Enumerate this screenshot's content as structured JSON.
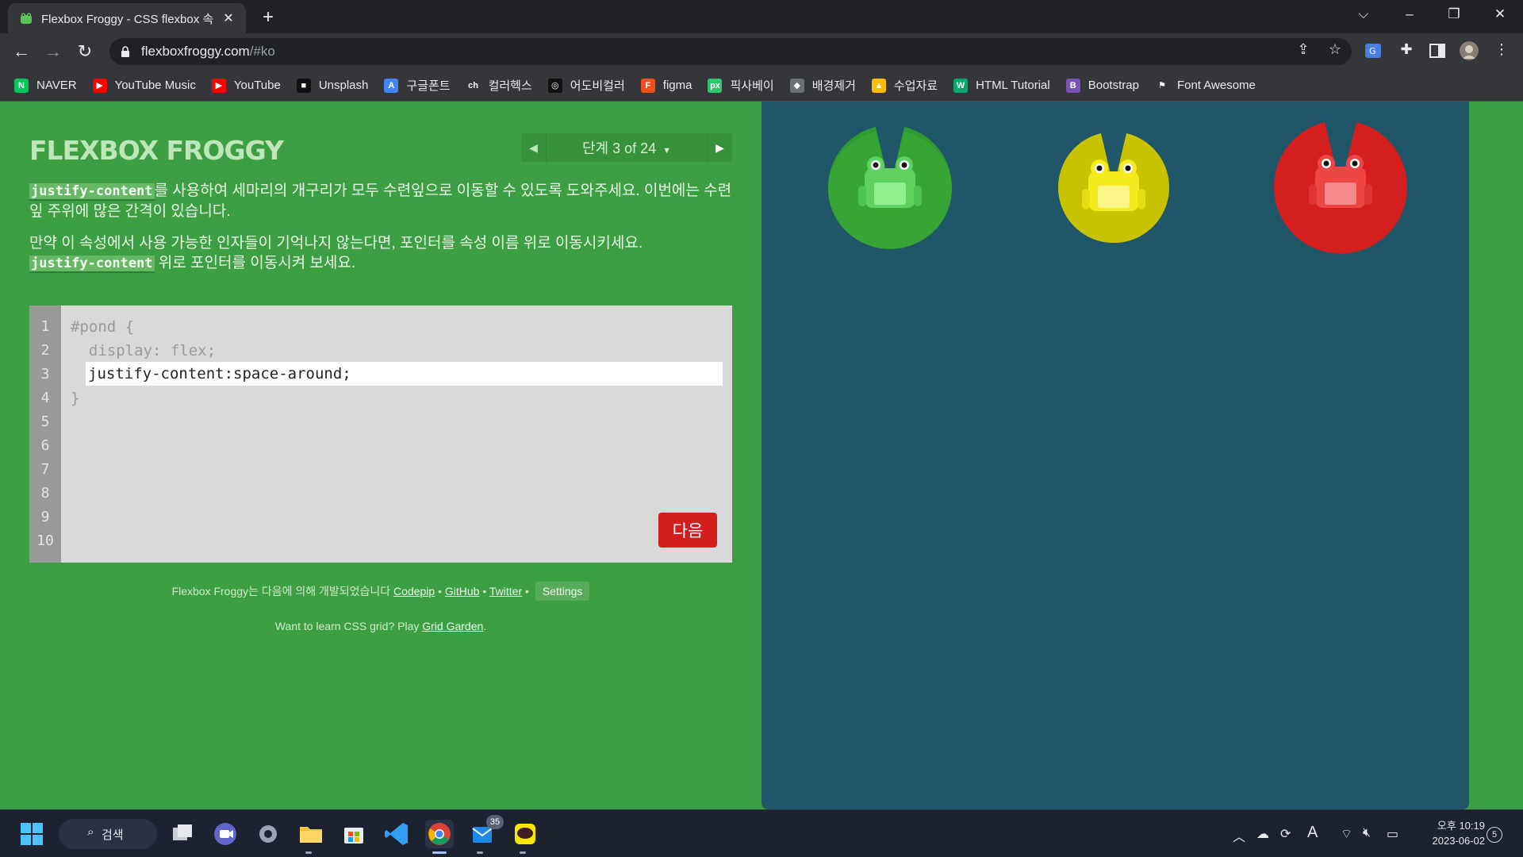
{
  "browser": {
    "tab_title": "Flexbox Froggy - CSS flexbox 속",
    "url_host": "flexboxfroggy.com",
    "url_path": "/#ko"
  },
  "bookmarks": [
    {
      "label": "NAVER",
      "icon": "naver-icon",
      "color": "#03c75a",
      "glyph": "N"
    },
    {
      "label": "YouTube Music",
      "icon": "youtube-music-icon",
      "color": "#ff0000",
      "glyph": "▶"
    },
    {
      "label": "YouTube",
      "icon": "youtube-icon",
      "color": "#ff0000",
      "glyph": "▶"
    },
    {
      "label": "Unsplash",
      "icon": "unsplash-icon",
      "color": "#111111",
      "glyph": "■"
    },
    {
      "label": "구글폰트",
      "icon": "google-fonts-icon",
      "color": "#4285f4",
      "glyph": "A"
    },
    {
      "label": "컬러헥스",
      "icon": "colorhex-icon",
      "color": "#35363a",
      "glyph": "ch"
    },
    {
      "label": "어도비컬러",
      "icon": "adobe-color-icon",
      "color": "#111111",
      "glyph": "◎"
    },
    {
      "label": "figma",
      "icon": "figma-icon",
      "color": "#f24e1e",
      "glyph": "F"
    },
    {
      "label": "픽사베이",
      "icon": "pixabay-icon",
      "color": "#2ec66d",
      "glyph": "px"
    },
    {
      "label": "배경제거",
      "icon": "remove-bg-icon",
      "color": "#6b6f76",
      "glyph": "◆"
    },
    {
      "label": "수업자료",
      "icon": "google-drive-icon",
      "color": "#fbbc04",
      "glyph": "▲"
    },
    {
      "label": "HTML Tutorial",
      "icon": "w3schools-icon",
      "color": "#04aa6d",
      "glyph": "W"
    },
    {
      "label": "Bootstrap",
      "icon": "bootstrap-icon",
      "color": "#7952b3",
      "glyph": "B"
    },
    {
      "label": "Font Awesome",
      "icon": "font-awesome-icon",
      "color": "#35363a",
      "glyph": "⚑"
    }
  ],
  "game": {
    "logo": "FLEXBOX FROGGY",
    "level_label": "단계 3 of 24",
    "desc1_code": "justify-content",
    "desc1_text": "를 사용하여 세마리의 개구리가 모두 수련잎으로 이동할 수 있도록 도와주세요. 이번에는 수련잎 주위에 많은 간격이 있습니다.",
    "desc2_text": "만약 이 속성에서 사용 가능한 인자들이 기억나지 않는다면, 포인터를 속성 이름 위로 이동시키세요.",
    "desc3_code": "justify-content",
    "desc3_text": " 위로 포인터를 이동시켜 보세요.",
    "line_numbers": [
      "1",
      "2",
      "3",
      "4",
      "5",
      "6",
      "7",
      "8",
      "9",
      "10"
    ],
    "code_line1": "#pond {",
    "code_line2": "  display: flex;",
    "code_line4": "}",
    "code_input_value": "justify-content:space-around;",
    "next_label": "다음",
    "credits_prefix": "Flexbox Froggy는 다음에 의해 개발되었습니다 ",
    "credits_link1": "Codepip",
    "credits_link2": "GitHub",
    "credits_link3": "Twitter",
    "settings_label": "Settings",
    "grid_prefix": "Want to learn CSS grid? Play ",
    "grid_link": "Grid Garden",
    "grid_suffix": ".",
    "frog_colors": [
      "green",
      "yellow",
      "red"
    ]
  },
  "taskbar": {
    "search_label": "검색",
    "mail_badge": "35",
    "time": "오후 10:19",
    "date": "2023-06-02",
    "notification_count": "5"
  }
}
